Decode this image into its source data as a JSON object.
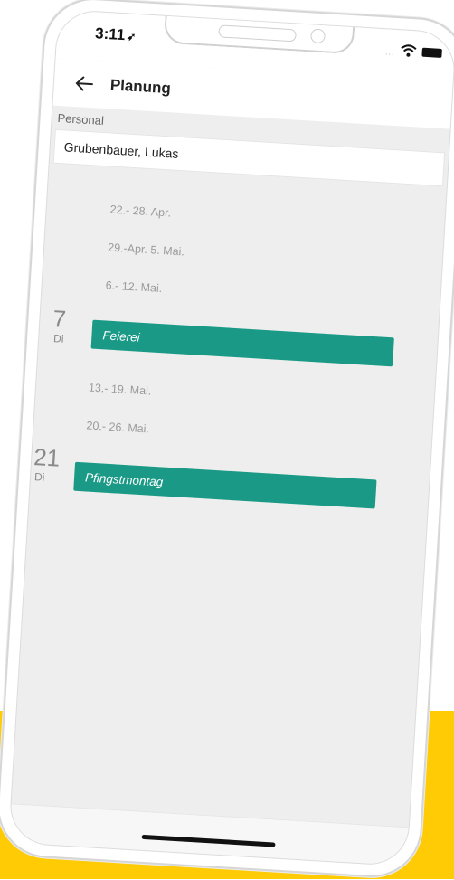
{
  "status_bar": {
    "time": "3:11",
    "signal_dots": "....",
    "location_glyph": "➶"
  },
  "header": {
    "title": "Planung"
  },
  "personal": {
    "label": "Personal",
    "value": "Grubenbauer, Lukas"
  },
  "schedule": {
    "weeks": [
      "22.- 28. Apr.",
      "29.-Apr. 5. Mai.",
      "6.- 12. Mai.",
      "13.- 19. Mai.",
      "20.- 26. Mai."
    ],
    "events": [
      {
        "day": "7",
        "weekday": "Di",
        "label": "Feierei"
      },
      {
        "day": "21",
        "weekday": "Di",
        "label": "Pfingstmontag"
      }
    ]
  },
  "colors": {
    "accent": "#1a9a86",
    "band": "#ffcb05",
    "background": "#eeeeee"
  },
  "icons": {
    "back": "arrow-left-icon",
    "wifi": "wifi-icon",
    "battery": "battery-icon"
  }
}
